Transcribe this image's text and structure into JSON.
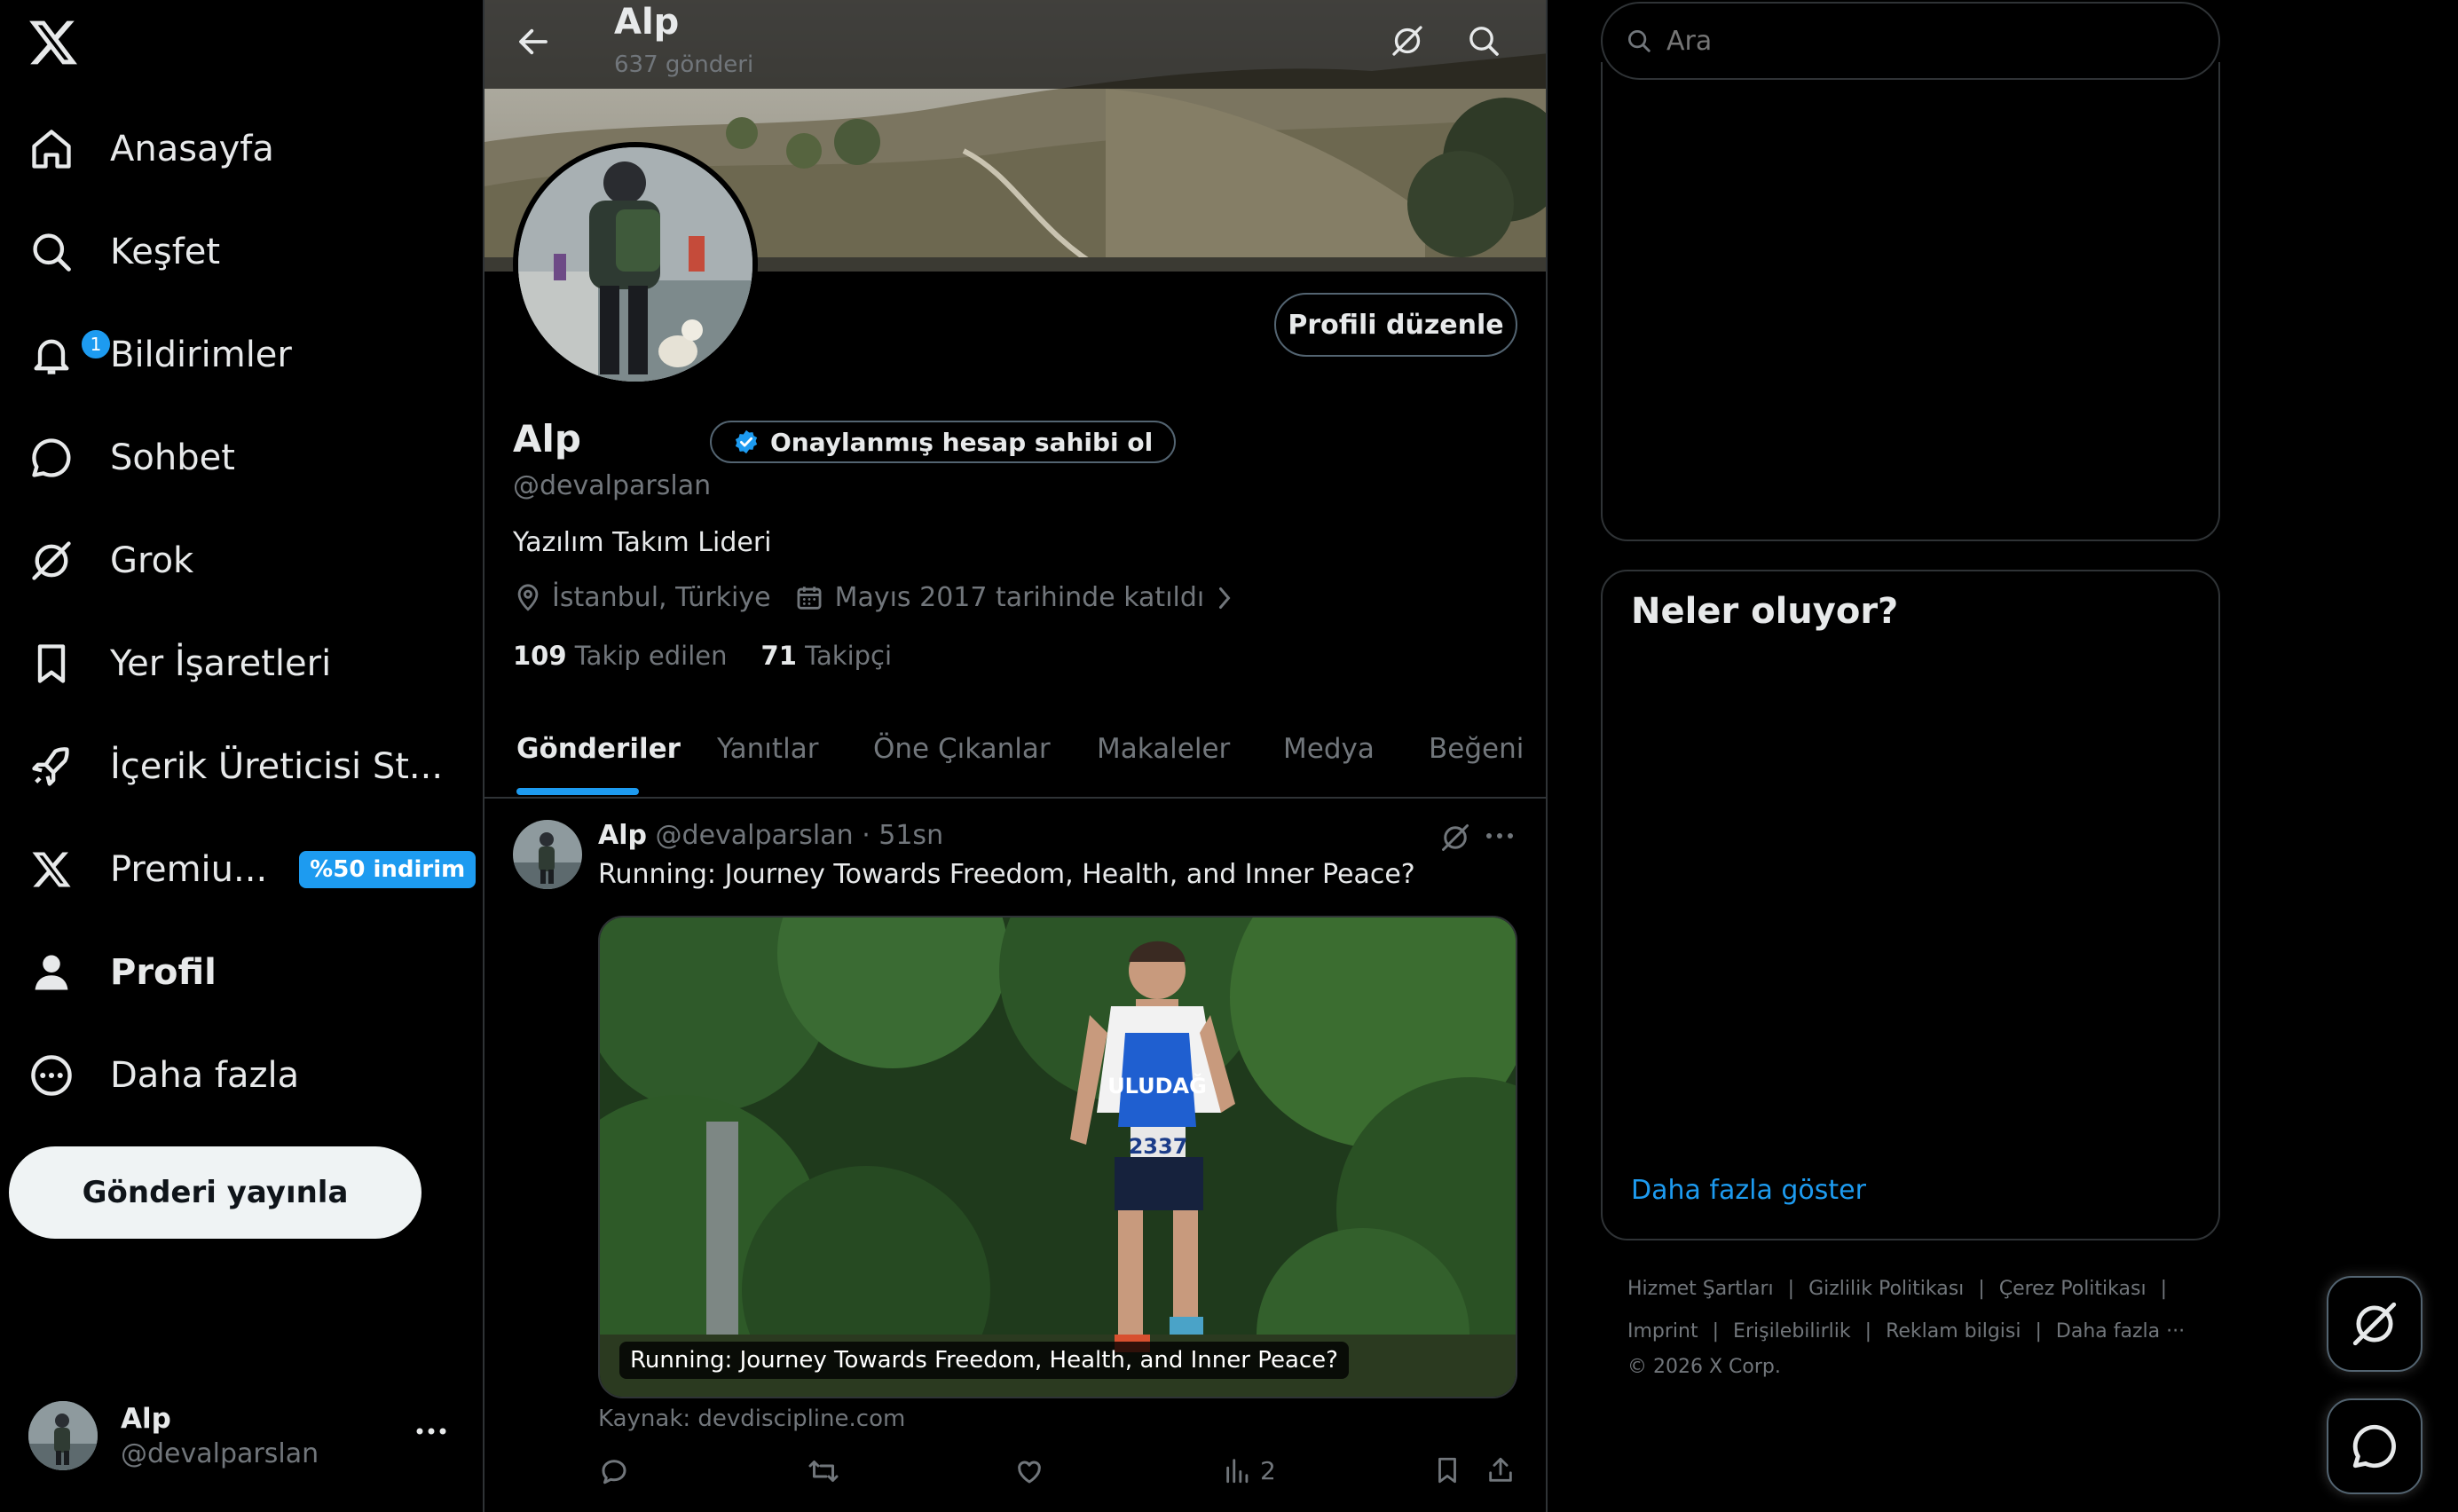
{
  "nav": {
    "items": [
      {
        "label": "Anasayfa",
        "icon": "home-icon"
      },
      {
        "label": "Keşfet",
        "icon": "search-icon"
      },
      {
        "label": "Bildirimler",
        "icon": "bell-icon",
        "badge": "1"
      },
      {
        "label": "Sohbet",
        "icon": "chat-icon"
      },
      {
        "label": "Grok",
        "icon": "grok-icon"
      },
      {
        "label": "Yer İşaretleri",
        "icon": "bookmark-icon"
      },
      {
        "label": "İçerik Üreticisi St...",
        "icon": "rocket-icon"
      },
      {
        "label": "Premiu...",
        "icon": "x-logo-icon",
        "promo": "%50 indirim"
      },
      {
        "label": "Profil",
        "icon": "person-icon"
      },
      {
        "label": "Daha fazla",
        "icon": "more-circle-icon"
      }
    ],
    "post_button": "Gönderi yayınla",
    "account": {
      "name": "Alp",
      "handle": "@devalparslan"
    }
  },
  "header": {
    "title": "Alp",
    "subtitle": "637 gönderi"
  },
  "profile": {
    "edit_button": "Profili düzenle",
    "name": "Alp",
    "verify_button": "Onaylanmış hesap sahibi ol",
    "handle": "@devalparslan",
    "bio": "Yazılım Takım Lideri",
    "location": "İstanbul, Türkiye",
    "joined": "Mayıs 2017 tarihinde katıldı",
    "following_count": "109",
    "following_label": "Takip edilen",
    "followers_count": "71",
    "followers_label": "Takipçi"
  },
  "tabs": [
    "Gönderiler",
    "Yanıtlar",
    "Öne Çıkanlar",
    "Makaleler",
    "Medya",
    "Beğeni"
  ],
  "post": {
    "author": "Alp",
    "handle": "@devalparslan",
    "time": "· 51sn",
    "text": "Running: Journey Towards Freedom, Health, and Inner Peace?",
    "card_title": "Running: Journey Towards Freedom, Health, and Inner Peace?",
    "bib_number": "2337",
    "bib_brand": "ULUDAĞ",
    "source": "Kaynak: devdiscipline.com",
    "views": "2"
  },
  "search": {
    "placeholder": "Ara"
  },
  "trends": {
    "title": "Neler oluyor?",
    "show_more": "Daha fazla göster"
  },
  "footer": {
    "links_row1": [
      "Hizmet Şartları",
      "Gizlilik Politikası",
      "Çerez Politikası"
    ],
    "links_row2": [
      "Imprint",
      "Erişilebilirlik",
      "Reklam bilgisi",
      "Daha fazla ···"
    ],
    "copyright": "© 2026 X Corp."
  },
  "colors": {
    "accent": "#1d9bf0",
    "background": "#000000",
    "border": "#2f3336",
    "muted": "#71767b",
    "text": "#e7e9ea"
  }
}
